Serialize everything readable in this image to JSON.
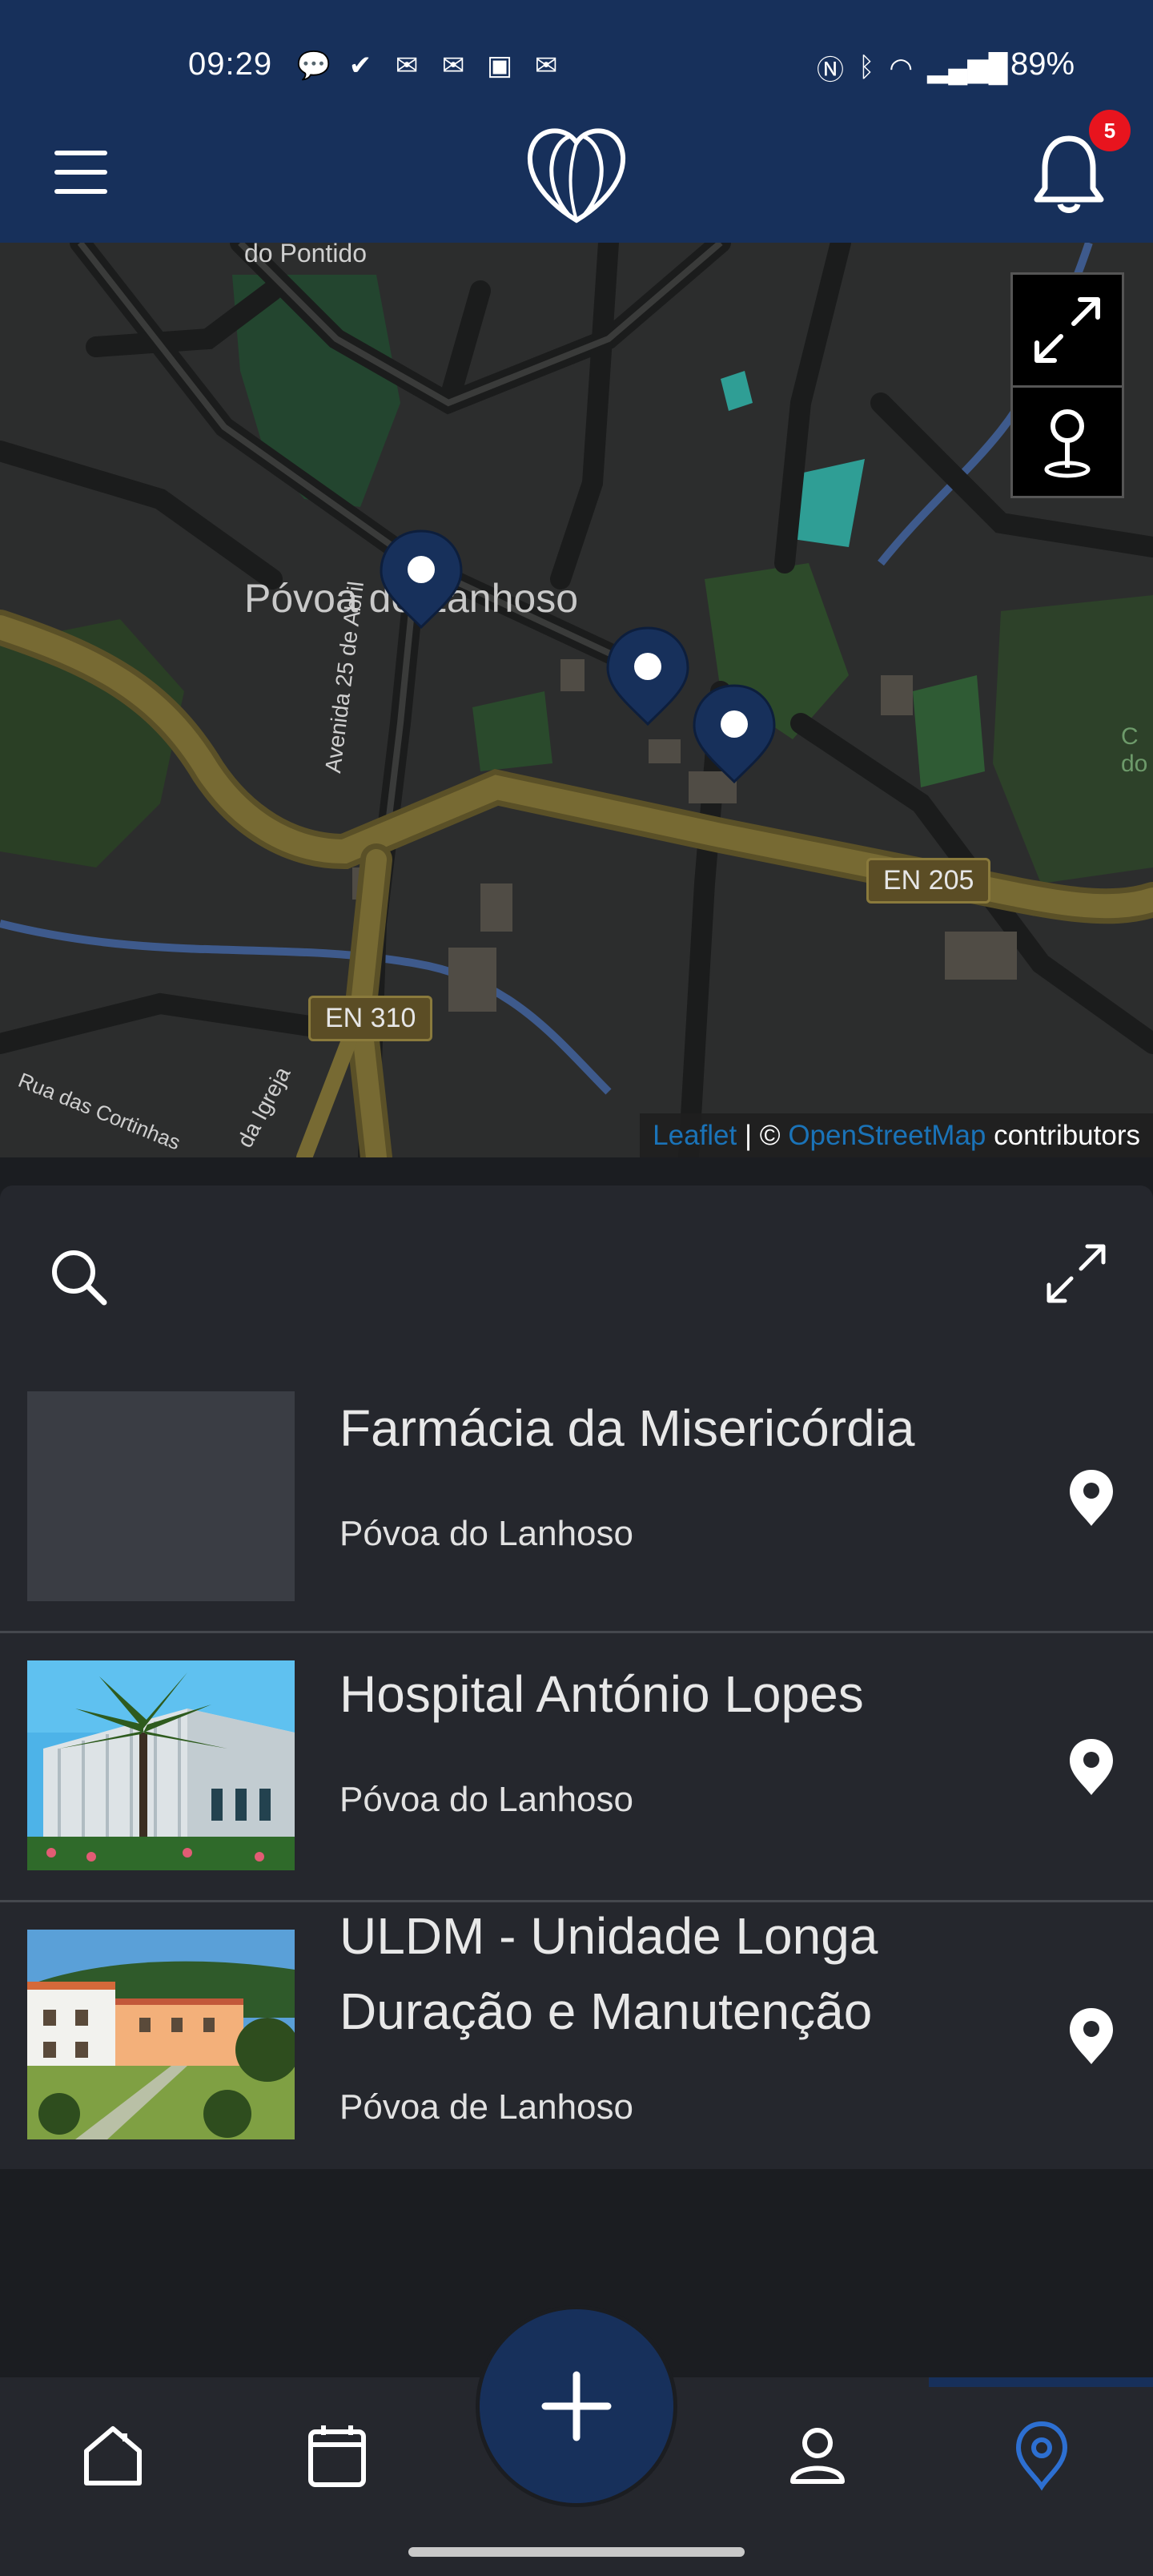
{
  "status_bar": {
    "time": "09:29",
    "battery": "89%",
    "notification_icons": [
      "chat-bubble-icon",
      "check-icon",
      "outlook-icon",
      "outlook-icon",
      "teams-icon",
      "outlook-icon"
    ],
    "system_icons": [
      "nfc-icon",
      "bluetooth-icon",
      "wifi-icon",
      "signal-icon"
    ]
  },
  "header": {
    "notification_count": "5"
  },
  "map": {
    "place_labels": {
      "top": "do Pontido",
      "town": "Póvoa de Lanhoso",
      "avenue": "Avenida 25 de Abril",
      "street": "Rua das Cortinhas",
      "igreja": "da Igreja",
      "right_edge": "C do"
    },
    "road_shields": {
      "en205": "EN 205",
      "en310": "EN 310"
    },
    "attribution": {
      "leaflet": "Leaflet",
      "separator": " | © ",
      "osm": "OpenStreetMap",
      "suffix": " contributors"
    }
  },
  "places": [
    {
      "title_lines": [
        "Farmácia da Misericórdia"
      ],
      "location": "Póvoa do Lanhoso",
      "image": "none"
    },
    {
      "title_lines": [
        "Hospital António Lopes"
      ],
      "location": "Póvoa do Lanhoso",
      "image": "hospital-building-photo"
    },
    {
      "title_lines": [
        "ULDM - Unidade Longa",
        "Duração e Manutenção"
      ],
      "location": "Póvoa de Lanhoso",
      "image": "care-unit-building-photo"
    }
  ],
  "bottom_nav": {
    "items": [
      "home-icon",
      "calendar-icon",
      "add-icon",
      "profile-icon",
      "map-pin-icon"
    ],
    "active": "map-pin-icon"
  },
  "colors": {
    "primary": "#17305b",
    "panel": "#25272d",
    "background": "#1b1d21",
    "badge": "#e8141e",
    "link": "#1a73b8",
    "active_nav": "#2d6fd1"
  }
}
